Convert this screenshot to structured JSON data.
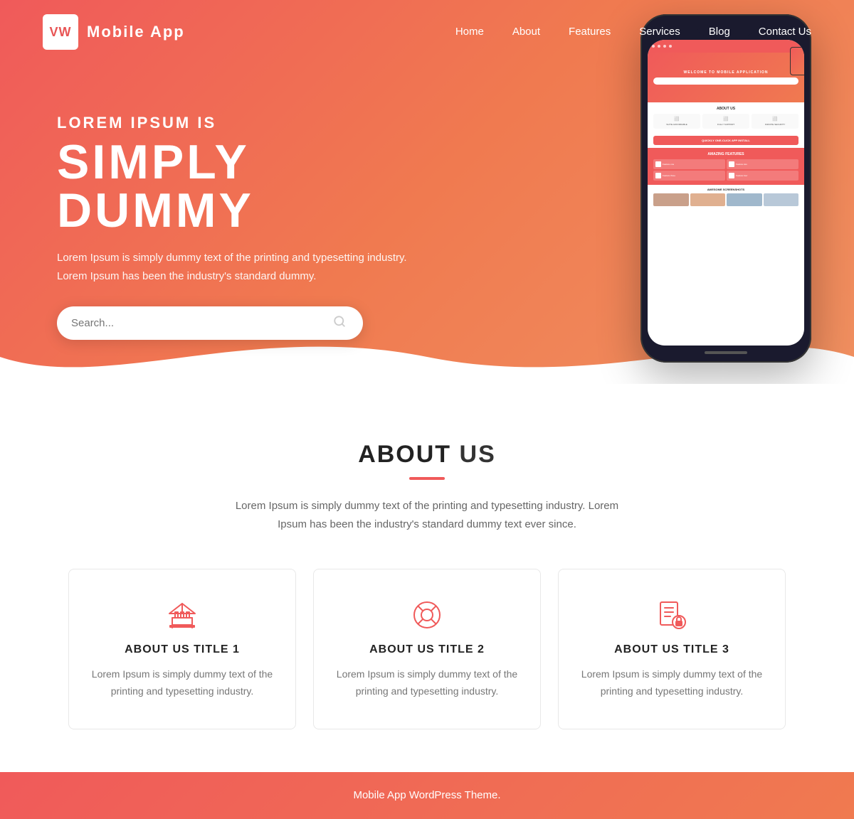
{
  "brand": {
    "logo_text": "VW",
    "app_name": "Mobile App"
  },
  "nav": {
    "links": [
      {
        "label": "Home",
        "href": "#"
      },
      {
        "label": "About",
        "href": "#"
      },
      {
        "label": "Features",
        "href": "#"
      },
      {
        "label": "Services",
        "href": "#"
      },
      {
        "label": "Blog",
        "href": "#"
      },
      {
        "label": "Contact Us",
        "href": "#"
      }
    ]
  },
  "hero": {
    "subtitle": "Lorem Ipsum Is",
    "title": "Simply Dummy",
    "description_line1": "Lorem Ipsum is simply dummy text of the printing and typesetting industry.",
    "description_line2": "Lorem Ipsum has been the industry's standard dummy.",
    "search_placeholder": "Search..."
  },
  "phone_mockup": {
    "mini_title": "WELCOME TO MOBILE APPLICATION",
    "mini_about": "ABOUT US",
    "mini_features": "AMAZING FEATURES",
    "mini_screenshots": "AWESOME SCREENSHOTS",
    "mini_cta": "QUICKLY ONE-CLICK APP INSTALL"
  },
  "about_section": {
    "title_bold": "ABOUT",
    "title_rest": "US",
    "description": "Lorem Ipsum is simply dummy text of the printing and typesetting industry. Lorem Ipsum has been the industry's standard dummy text ever since.",
    "cards": [
      {
        "icon": "building",
        "title": "ABOUT US TITLE 1",
        "desc": "Lorem Ipsum is simply dummy text of the printing and typesetting industry."
      },
      {
        "icon": "lifebuoy",
        "title": "ABOUT US TITLE 2",
        "desc": "Lorem Ipsum is simply dummy text of the printing and typesetting industry."
      },
      {
        "icon": "document",
        "title": "ABOUT US TITLE 3",
        "desc": "Lorem Ipsum is simply dummy text of the printing and typesetting industry."
      }
    ]
  },
  "footer": {
    "text": "Mobile App WordPress Theme."
  }
}
